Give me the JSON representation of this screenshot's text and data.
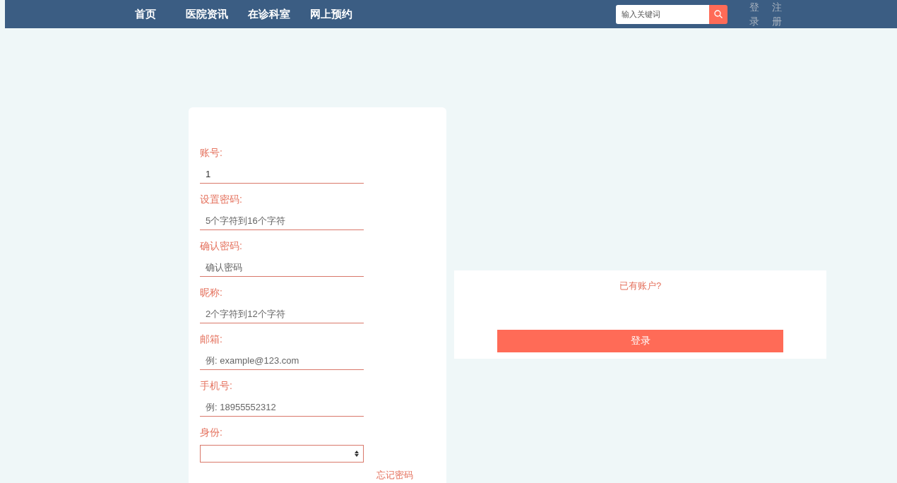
{
  "nav": {
    "links": [
      {
        "label": "首页"
      },
      {
        "label": "医院资讯"
      },
      {
        "label": "在诊科室"
      },
      {
        "label": "网上预约"
      }
    ],
    "search": {
      "placeholder": "输入关键词"
    },
    "auth_links": [
      {
        "label": "登录"
      },
      {
        "label": "注册"
      }
    ]
  },
  "register_form": {
    "fields": [
      {
        "kind": "text",
        "label": "账号:",
        "value": "1"
      },
      {
        "kind": "text",
        "label": "设置密码:",
        "placeholder": "5个字符到16个字符"
      },
      {
        "kind": "text",
        "label": "确认密码:",
        "placeholder": "确认密码"
      },
      {
        "kind": "text",
        "label": "昵称:",
        "placeholder": "2个字符到12个字符"
      },
      {
        "kind": "text",
        "label": "邮箱:",
        "placeholder": "例: example@123.com"
      },
      {
        "kind": "text",
        "label": "手机号:",
        "placeholder": "例: 18955552312"
      },
      {
        "kind": "select",
        "label": "身份:"
      }
    ],
    "forgot_link": "忘记密码"
  },
  "login_panel": {
    "prompt": "已有账户?",
    "button": "登录"
  }
}
